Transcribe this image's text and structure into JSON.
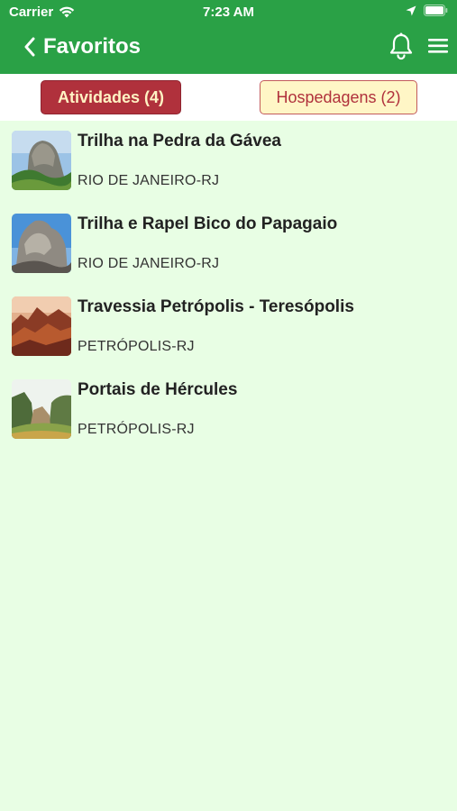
{
  "status_bar": {
    "carrier": "Carrier",
    "time": "7:23 AM"
  },
  "header": {
    "title": "Favoritos"
  },
  "tabs": [
    {
      "label": "Atividades (4)",
      "active": true
    },
    {
      "label": "Hospedagens (2)",
      "active": false
    }
  ],
  "items": [
    {
      "title": "Trilha na Pedra da Gávea",
      "location": "RIO DE JANEIRO-RJ"
    },
    {
      "title": "Trilha e Rapel Bico do Papagaio",
      "location": "RIO DE JANEIRO-RJ"
    },
    {
      "title": "Travessia Petrópolis - Teresópolis",
      "location": "PETRÓPOLIS-RJ"
    },
    {
      "title": "Portais de Hércules",
      "location": "PETRÓPOLIS-RJ"
    }
  ],
  "colors": {
    "header": "#2aa146",
    "background": "#e8fee4",
    "tab_active": "#b0313c",
    "tab_inactive": "#fff6c6"
  }
}
